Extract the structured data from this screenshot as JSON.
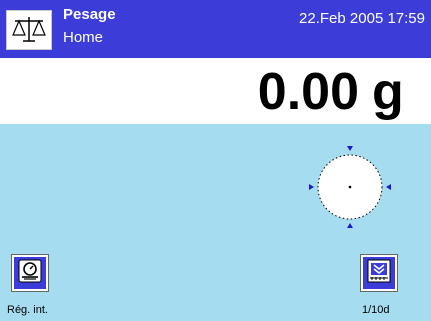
{
  "header": {
    "title": "Pesage",
    "subtitle": "Home",
    "datetime": "22.Feb 2005  17:59",
    "app_icon": "balance-scale-icon"
  },
  "result": {
    "value": "0.00",
    "unit": "g"
  },
  "softkeys": {
    "left": {
      "label": "Rég. int.",
      "icon": "internal-calibration-icon"
    },
    "right": {
      "label": "1/10d",
      "icon": "readability-icon"
    }
  },
  "colors": {
    "header_bg": "#3c3cd8",
    "main_bg": "#a6dcf0",
    "button_bg": "#3c3cd8"
  }
}
